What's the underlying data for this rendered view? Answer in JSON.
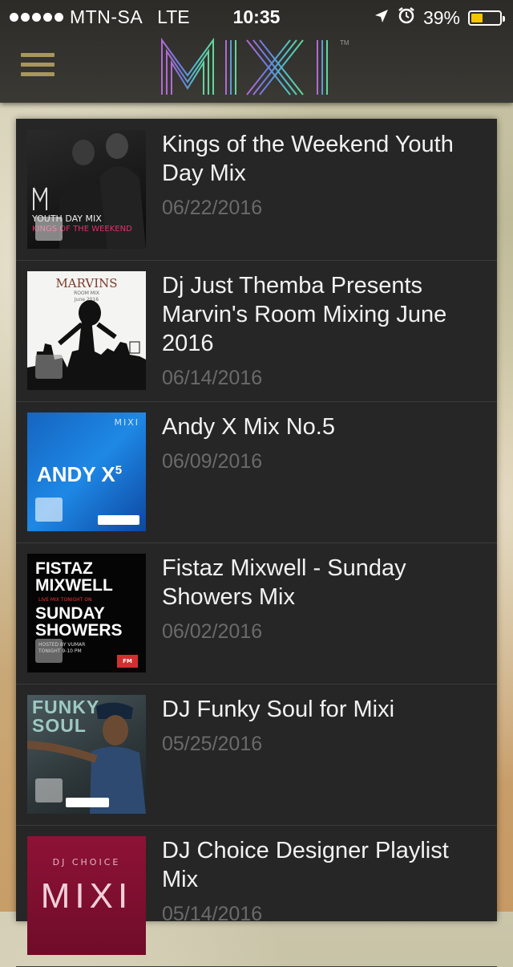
{
  "status_bar": {
    "carrier": "MTN-SA",
    "network": "LTE",
    "time": "10:35",
    "battery": "39%",
    "battery_level": 0.39
  },
  "header": {
    "app_logo": "MIXI",
    "menu_icon": "hamburger-icon"
  },
  "mixes": [
    {
      "title": "Kings of the Weekend Youth Day Mix",
      "date": "06/22/2016",
      "cover": {
        "logo": "M",
        "line1": "YOUTH DAY MIX",
        "line2": "KINGS OF THE WEEKEND"
      }
    },
    {
      "title": "Dj Just Themba Presents Marvin's Room Mixing June 2016",
      "date": "06/14/2016",
      "cover": {
        "heading": "MARVINS",
        "sub": "ROOM MIX",
        "sub2": "June 2016"
      }
    },
    {
      "title": "Andy X Mix No.5",
      "date": "06/09/2016",
      "cover": {
        "logo": "MIXI",
        "name": "ANDY X",
        "sup": "5"
      }
    },
    {
      "title": "Fistaz Mixwell - Sunday Showers Mix",
      "date": "06/02/2016",
      "cover": {
        "line1": "FISTAZ",
        "line2": "MIXWELL",
        "line3": "LIVE MIX TONIGHT ON",
        "line4": "SUNDAY",
        "line5": "SHOWERS",
        "line6": "HOSTED BY VUMAR",
        "line7": "TONIGHT 9-10 PM",
        "badge": "FM"
      }
    },
    {
      "title": "DJ Funky Soul for Mixi",
      "date": "05/25/2016",
      "cover": {
        "line1": "FUNKY",
        "line2": "SOUL"
      }
    },
    {
      "title": "DJ Choice Designer Playlist Mix",
      "date": "05/14/2016",
      "cover": {
        "line1": "DJ CHOICE",
        "logo": "MIXI"
      }
    }
  ],
  "colors": {
    "accent_gold": "#a8975c",
    "panel_bg": "#262626",
    "date_gray": "#6a6a6a",
    "battery_yellow": "#f5c400"
  }
}
